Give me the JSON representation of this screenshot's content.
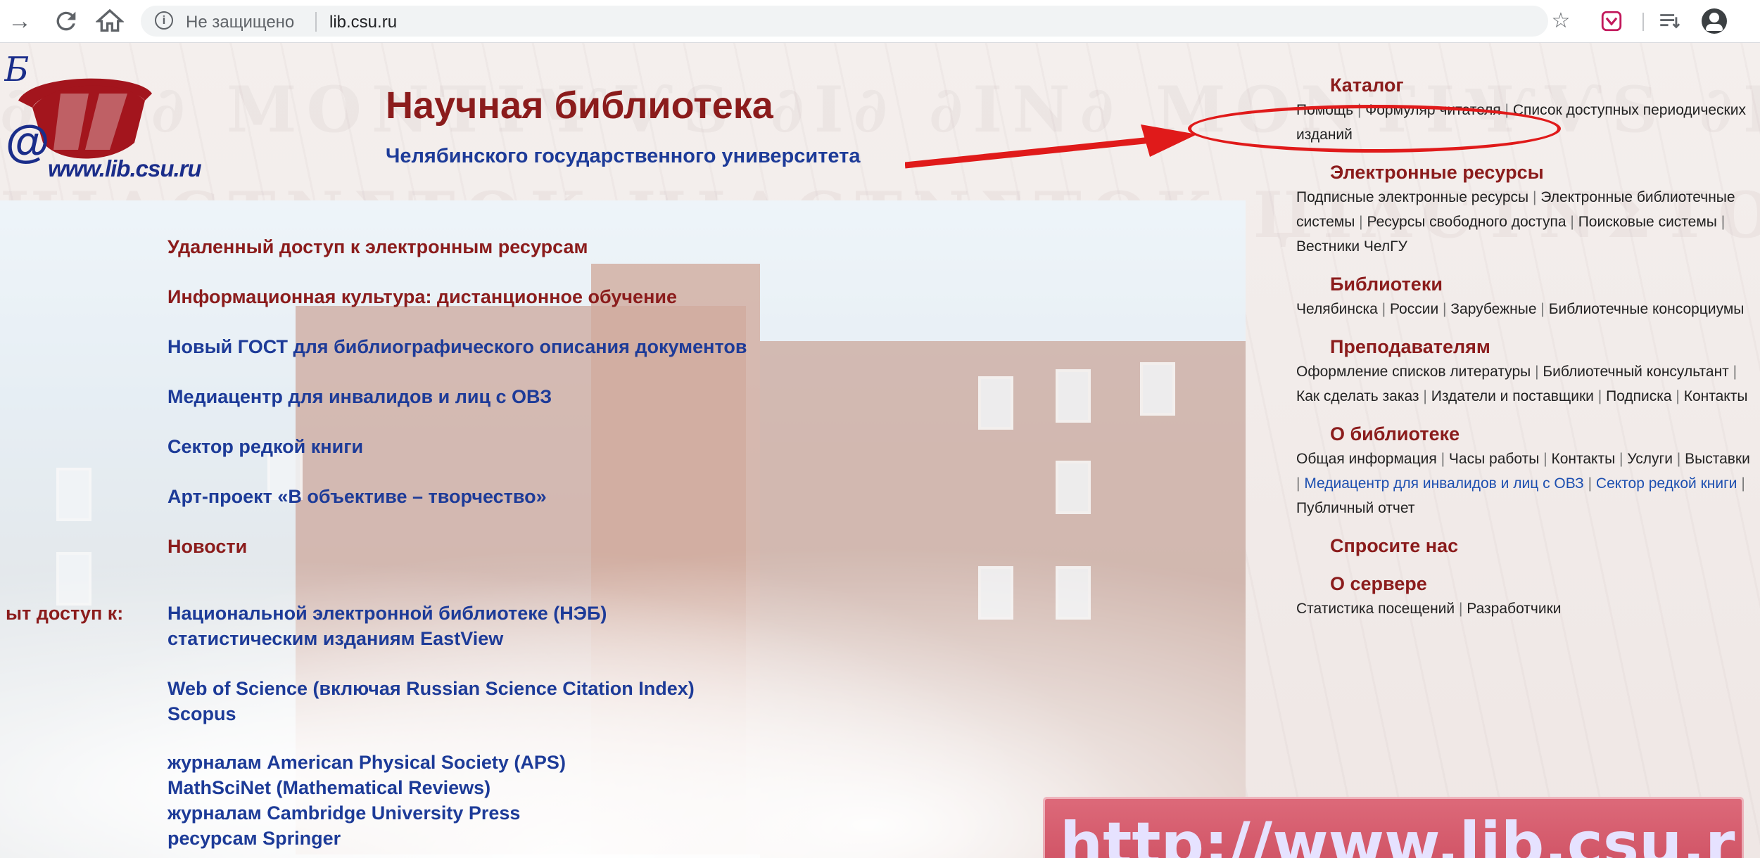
{
  "browser": {
    "security_label": "Не защищено",
    "url": "lib.csu.ru",
    "icons": [
      "forward-icon",
      "reload-icon",
      "home-icon",
      "info-icon",
      "star-icon",
      "extension-icon",
      "reading-list-icon",
      "profile-icon"
    ]
  },
  "logo": {
    "url_text": "www.lib.csu.ru"
  },
  "header": {
    "title": "Научная библиотека",
    "subtitle": "Челябинского государственного университета"
  },
  "main_links": [
    {
      "label": "Удаленный доступ к электронным ресурсам"
    },
    {
      "label": "Информационная культура: дистанционное обучение"
    },
    {
      "label": "Новый ГОСТ для библиографического описания документов"
    },
    {
      "label": "Медиацентр для инвалидов и лиц с ОВЗ"
    },
    {
      "label": "Сектор редкой книги"
    },
    {
      "label": "Арт-проект «В объективе – творчество»"
    },
    {
      "label": "Новости"
    }
  ],
  "access": {
    "label": "ыт доступ к:",
    "groups": [
      [
        "Национальной электронной библиотеке (НЭБ)",
        "статистическим изданиям EastView"
      ],
      [
        "Web of Science (включая Russian Science Citation Index)",
        "Scopus"
      ],
      [
        "журналам American Physical Society (APS)",
        "MathSciNet (Mathematical Reviews)",
        "журналам Cambridge University Press",
        "ресурсам Springer"
      ]
    ]
  },
  "sections": {
    "catalog": {
      "title": "Каталог",
      "links": [
        "Помощь",
        "Формуляр читателя",
        "Список доступных периодических изданий"
      ]
    },
    "eresources": {
      "title": "Электронные ресурсы",
      "links": [
        "Подписные электронные ресурсы",
        "Электронные библиотечные системы",
        "Ресурсы свободного доступа",
        "Поисковые системы",
        "Вестники ЧелГУ"
      ]
    },
    "libraries": {
      "title": "Библиотеки",
      "links": [
        "Челябинска",
        "России",
        "Зарубежные",
        "Библиотечные консорциумы"
      ]
    },
    "teachers": {
      "title": "Преподавателям",
      "links": [
        "Оформление списков литературы",
        "Библиотечный консультант",
        "Как сделать заказ",
        "Издатели и поставщики",
        "Подписка",
        "Контакты"
      ]
    },
    "about": {
      "title": "О библиотеке",
      "links": [
        "Общая информация",
        "Часы работы",
        "Контакты",
        "Услуги",
        "Выставки",
        "Медиацентр для инвалидов и лиц с ОВЗ",
        "Сектор редкой книги",
        "Публичный отчет"
      ]
    },
    "ask": {
      "title": "Спросите нас"
    },
    "server": {
      "title": "О сервере",
      "links": [
        "Статистика посещений",
        "Разработчики"
      ]
    }
  },
  "banner": {
    "text": "http://www.lib.csu.r"
  },
  "colors": {
    "title_red": "#8b1c1c",
    "link_blue": "#1d3b98",
    "annotation_red": "#e01a1a",
    "banner": "#d45a6c"
  }
}
